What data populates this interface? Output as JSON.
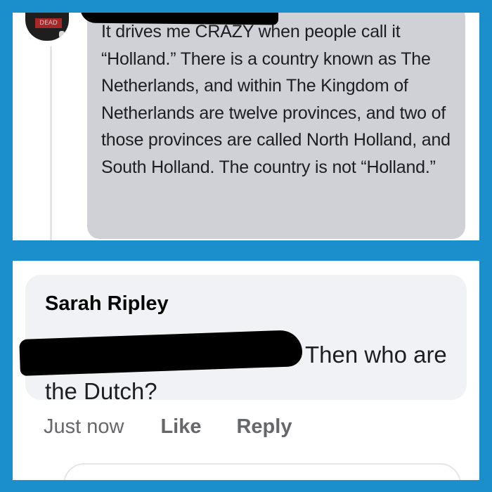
{
  "top_comment": {
    "avatar_label": "DEAD",
    "text": "It drives me CRAZY when people call it “Holland.” There is a country known as The Netherlands, and within The Kingdom of Netherlands are twelve provinces, and two of those provinces are called North Holland, and South Holland. The country is not “Holland.”"
  },
  "reply": {
    "author": "Sarah Ripley",
    "text": "Then who are the Dutch?",
    "timestamp": "Just now",
    "like_label": "Like",
    "reply_label": "Reply"
  },
  "colors": {
    "frame": "#1b8fcc",
    "bubble_top": "#cfd1d6",
    "bubble_bottom": "#f0f2f5",
    "meta_text": "#65676b"
  }
}
